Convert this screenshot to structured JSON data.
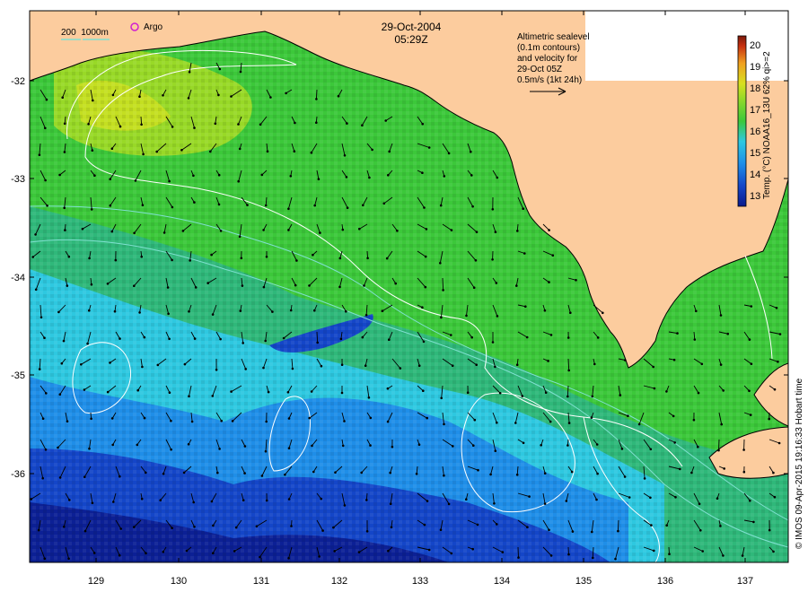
{
  "map": {
    "date": "29-Oct-2004",
    "time": "05:29Z",
    "lon_ticks": [
      "129",
      "130",
      "131",
      "132",
      "133",
      "134",
      "135",
      "136",
      "137"
    ],
    "lat_ticks": [
      "-32",
      "-33",
      "-34",
      "-35",
      "-36"
    ],
    "bathy_legend": "200  1000m",
    "argo_label": "Argo",
    "altimetry_note": [
      "Altimetric sealevel",
      "(0.1m contours)",
      "and velocity for",
      "29-Oct 05Z",
      "0.5m/s (1kt 24h)"
    ],
    "colorbar": {
      "title": "Temp. (°C) NOAA16_13U 62% qi>=2",
      "ticks": [
        "20",
        "19",
        "18",
        "17",
        "16",
        "15",
        "14",
        "13"
      ]
    },
    "credit": "© IMOS 09-Apr-2015 19:16:33 Hobart time",
    "colors": {
      "land": "#FCCC9E",
      "contour": "#ffffff",
      "bathy_200": "#7fe0d0",
      "argo": "#d020d0",
      "sst_palette": [
        "#0a1a8c",
        "#1446c8",
        "#1f8ee8",
        "#2ec8e0",
        "#2fb87a",
        "#3cc83a",
        "#8cd82a",
        "#d8e020",
        "#f0a020",
        "#c83010",
        "#7a1a0a"
      ]
    }
  }
}
